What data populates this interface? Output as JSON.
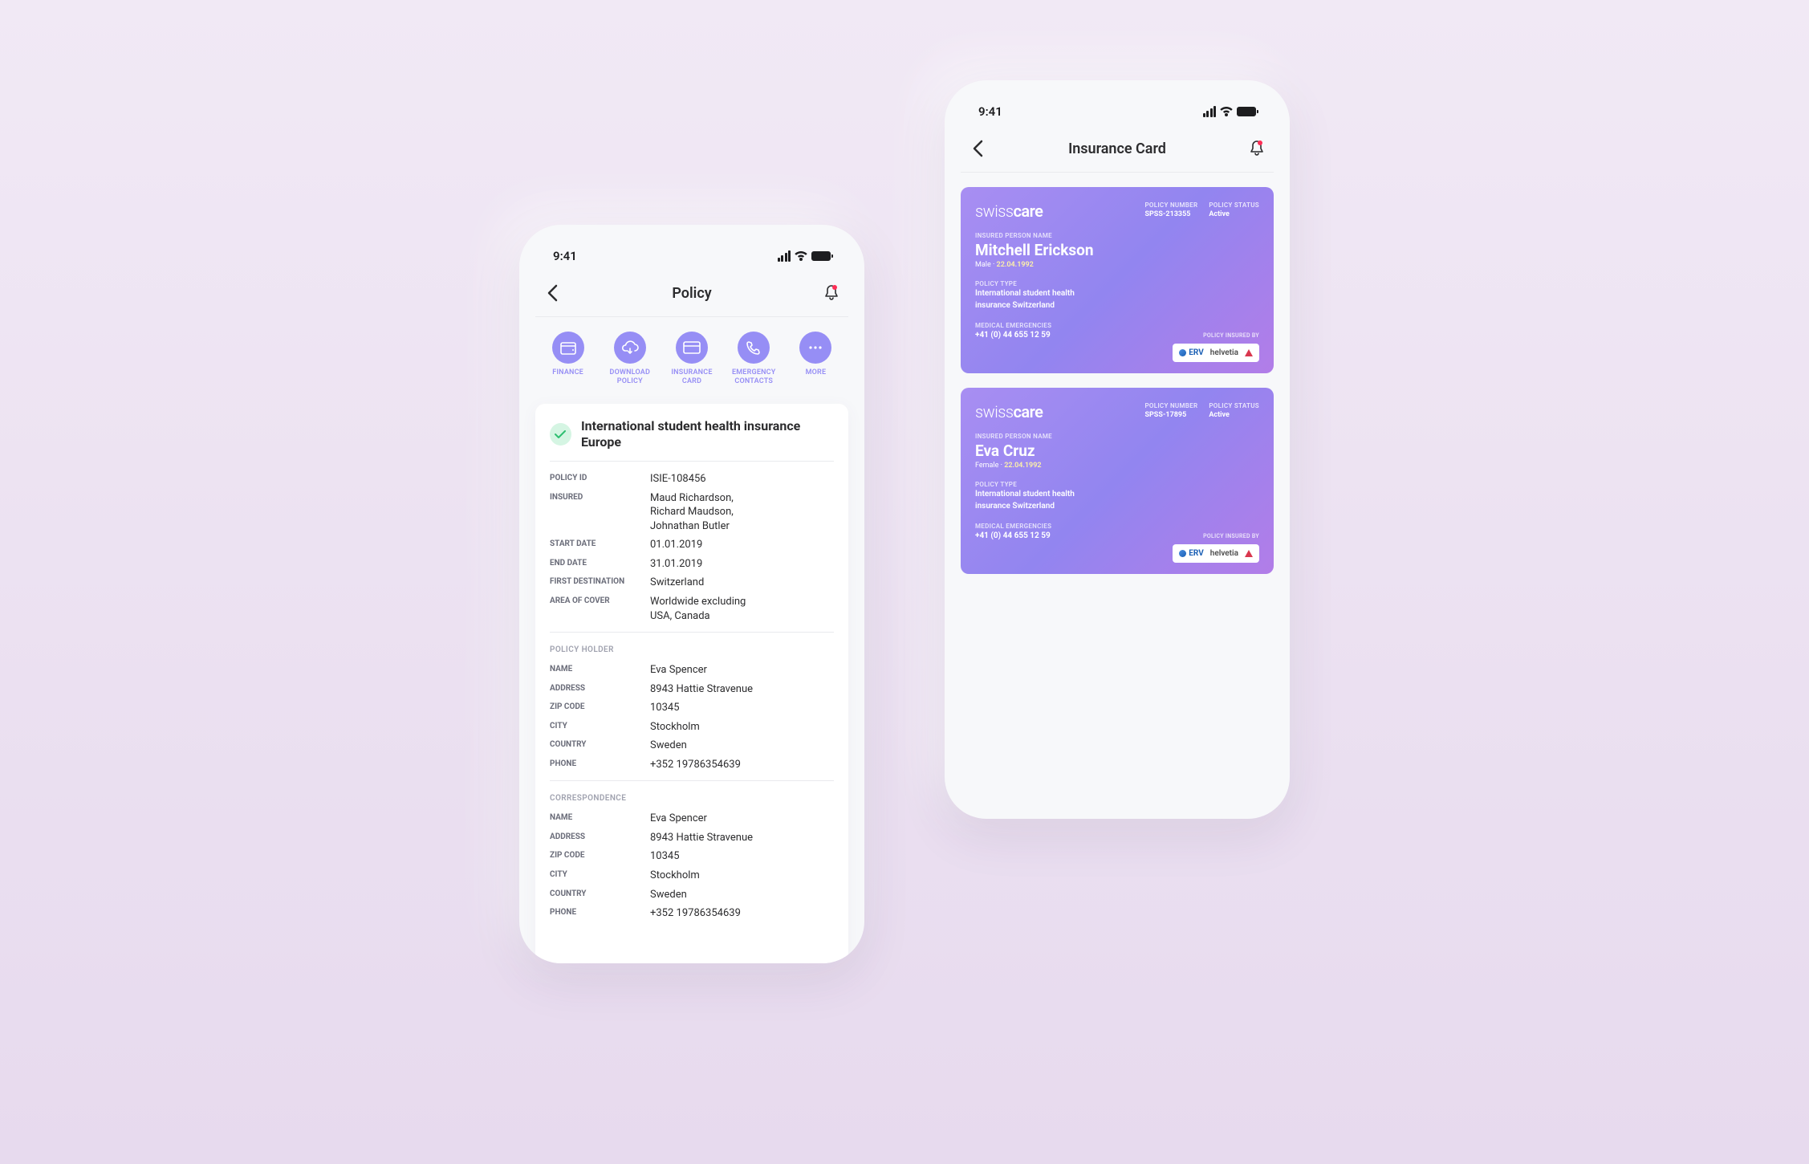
{
  "status": {
    "time": "9:41"
  },
  "phone1": {
    "header_title": "Policy",
    "actions": [
      {
        "label": "FINANCE"
      },
      {
        "label": "DOWNLOAD POLICY"
      },
      {
        "label": "INSURANCE CARD"
      },
      {
        "label": "EMERGENCY CONTACTS"
      },
      {
        "label": "MORE"
      }
    ],
    "policy_title": "International student health insurance Europe",
    "fields": {
      "policy_id_label": "POLICY ID",
      "policy_id": "ISIE-108456",
      "insured_label": "INSURED",
      "insured_1": "Maud Richardson,",
      "insured_2": "Richard Maudson,",
      "insured_3": "Johnathan Butler",
      "start_date_label": "START DATE",
      "start_date": "01.01.2019",
      "end_date_label": "END DATE",
      "end_date": "31.01.2019",
      "first_dest_label": "FIRST DESTINATION",
      "first_dest": "Switzerland",
      "area_label": "AREA OF COVER",
      "area_1": "Worldwide excluding",
      "area_2": "USA, Canada"
    },
    "holder": {
      "section_title": "POLICY HOLDER",
      "name_label": "NAME",
      "name": "Eva Spencer",
      "address_label": "ADDRESS",
      "address": "8943 Hattie Stravenue",
      "zip_label": "ZIP CODE",
      "zip": "10345",
      "city_label": "CITY",
      "city": "Stockholm",
      "country_label": "COUNTRY",
      "country": "Sweden",
      "phone_label": "PHONE",
      "phone": "+352 19786354639"
    },
    "corr": {
      "section_title": "CORRESPONDENCE",
      "name_label": "NAME",
      "name": "Eva Spencer",
      "address_label": "ADDRESS",
      "address": "8943 Hattie Stravenue",
      "zip_label": "ZIP CODE",
      "zip": "10345",
      "city_label": "CITY",
      "city": "Stockholm",
      "country_label": "COUNTRY",
      "country": "Sweden",
      "phone_label": "PHONE",
      "phone": "+352 19786354639"
    }
  },
  "phone2": {
    "header_title": "Insurance Card",
    "cards": [
      {
        "policy_number_label": "POLICY NUMBER",
        "policy_number": "SPSS-213355",
        "policy_status_label": "POLICY STATUS",
        "policy_status": "Active",
        "insured_label": "INSURED PERSON NAME",
        "insured_name": "Mitchell Erickson",
        "gender": "Male",
        "dob": "22.04.1992",
        "policy_type_label": "POLICY TYPE",
        "policy_type_1": "International student health",
        "policy_type_2": "insurance Switzerland",
        "emerg_label": "MEDICAL EMERGENCIES",
        "emerg_phone": "+41 (0) 44 655 12 59",
        "insured_by_label": "POLICY INSURED BY",
        "insurer1": "ERV",
        "insurer2": "helvetia"
      },
      {
        "policy_number_label": "POLICY NUMBER",
        "policy_number": "SPSS-17895",
        "policy_status_label": "POLICY STATUS",
        "policy_status": "Active",
        "insured_label": "INSURED PERSON NAME",
        "insured_name": "Eva Cruz",
        "gender": "Female",
        "dob": "22.04.1992",
        "policy_type_label": "POLICY TYPE",
        "policy_type_1": "International student health",
        "policy_type_2": "insurance Switzerland",
        "emerg_label": "MEDICAL EMERGENCIES",
        "emerg_phone": "+41 (0) 44 655 12 59",
        "insured_by_label": "POLICY INSURED BY",
        "insurer1": "ERV",
        "insurer2": "helvetia"
      }
    ]
  },
  "brand": "swisscare"
}
